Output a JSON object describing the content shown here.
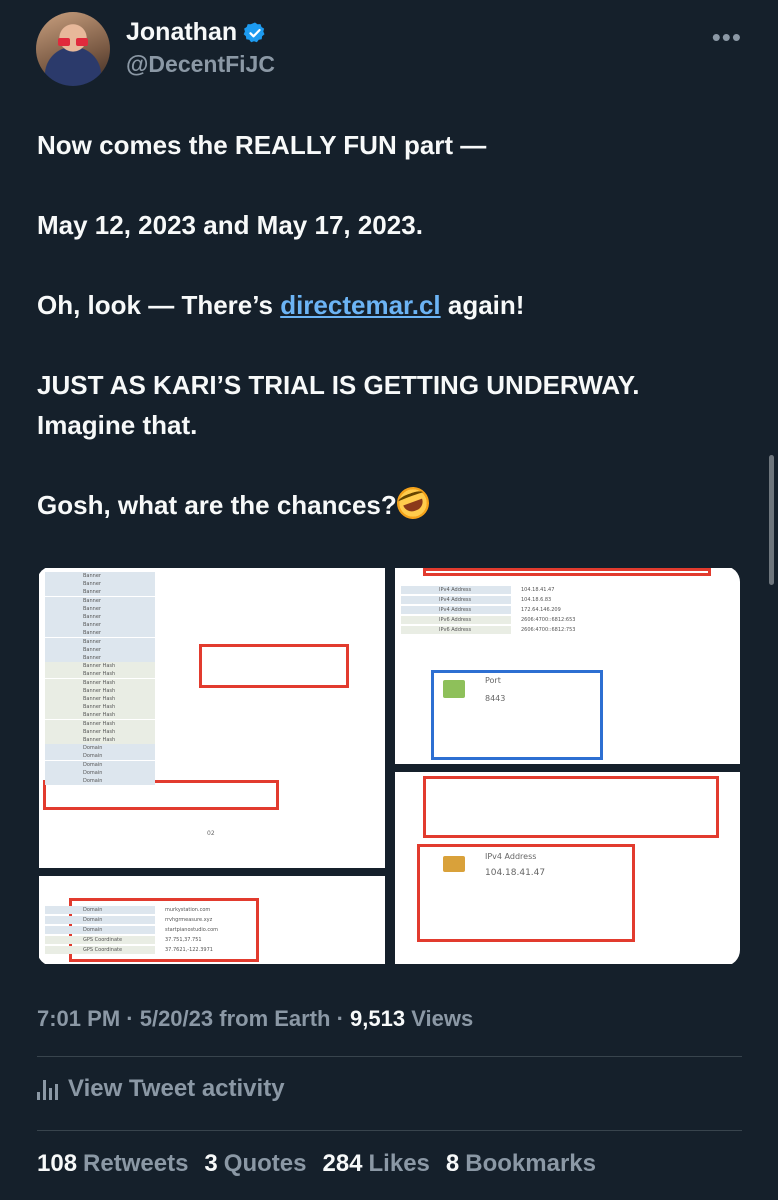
{
  "author": {
    "display_name": "Jonathan",
    "handle": "@DecentFiJC",
    "verified_icon": "verified-badge-icon",
    "avatar": "avatar-photo"
  },
  "menu": {
    "more_label": "•••"
  },
  "tweet": {
    "line1": "Now comes the REALLY FUN part —",
    "line2": "May 12, 2023 and May 17, 2023.",
    "line3_before": "Oh, look — There’s ",
    "line3_link": "directemar.cl",
    "line3_after": " again!",
    "line4a": "JUST AS KARI’S TRIAL IS GETTING UNDERWAY.",
    "line4b": "Imagine that.",
    "line5": "Gosh, what are the chances?",
    "emoji": "rolling-on-floor-laughing-emoji"
  },
  "media": {
    "panel1_rows": [
      "Banner",
      "Banner",
      "Banner",
      "Banner",
      "Banner",
      "Banner",
      "Banner",
      "Banner",
      "Banner",
      "Banner",
      "Banner",
      "Banner Hash",
      "Banner Hash",
      "Banner Hash",
      "Banner Hash",
      "Banner Hash",
      "Banner Hash",
      "Banner Hash",
      "Banner Hash",
      "Banner Hash",
      "Banner Hash",
      "Domain",
      "Domain",
      "Domain",
      "Domain",
      "Domain"
    ],
    "panel3_title": "Port",
    "panel3_port": "8443",
    "panel4_title": "IPv4 Address",
    "panel4_ip": "104.18.41.47"
  },
  "meta": {
    "time": "7:01 PM",
    "sep1": " · ",
    "date": "5/20/23",
    "from": " from Earth",
    "sep2": " · ",
    "views_count": "9,513",
    "views_label": " Views"
  },
  "activity": {
    "label": "View Tweet activity",
    "icon": "analytics-bars-icon"
  },
  "stats": {
    "retweets_count": "108",
    "retweets_label": "Retweets",
    "quotes_count": "3",
    "quotes_label": "Quotes",
    "likes_count": "284",
    "likes_label": "Likes",
    "bookmarks_count": "8",
    "bookmarks_label": "Bookmarks"
  },
  "colors": {
    "background": "#15202b",
    "text": "#f7f9f9",
    "secondary": "#8b98a5",
    "link": "#6cb4f5",
    "verified": "#1d9bf0",
    "highlight_red": "#e23b2e"
  }
}
